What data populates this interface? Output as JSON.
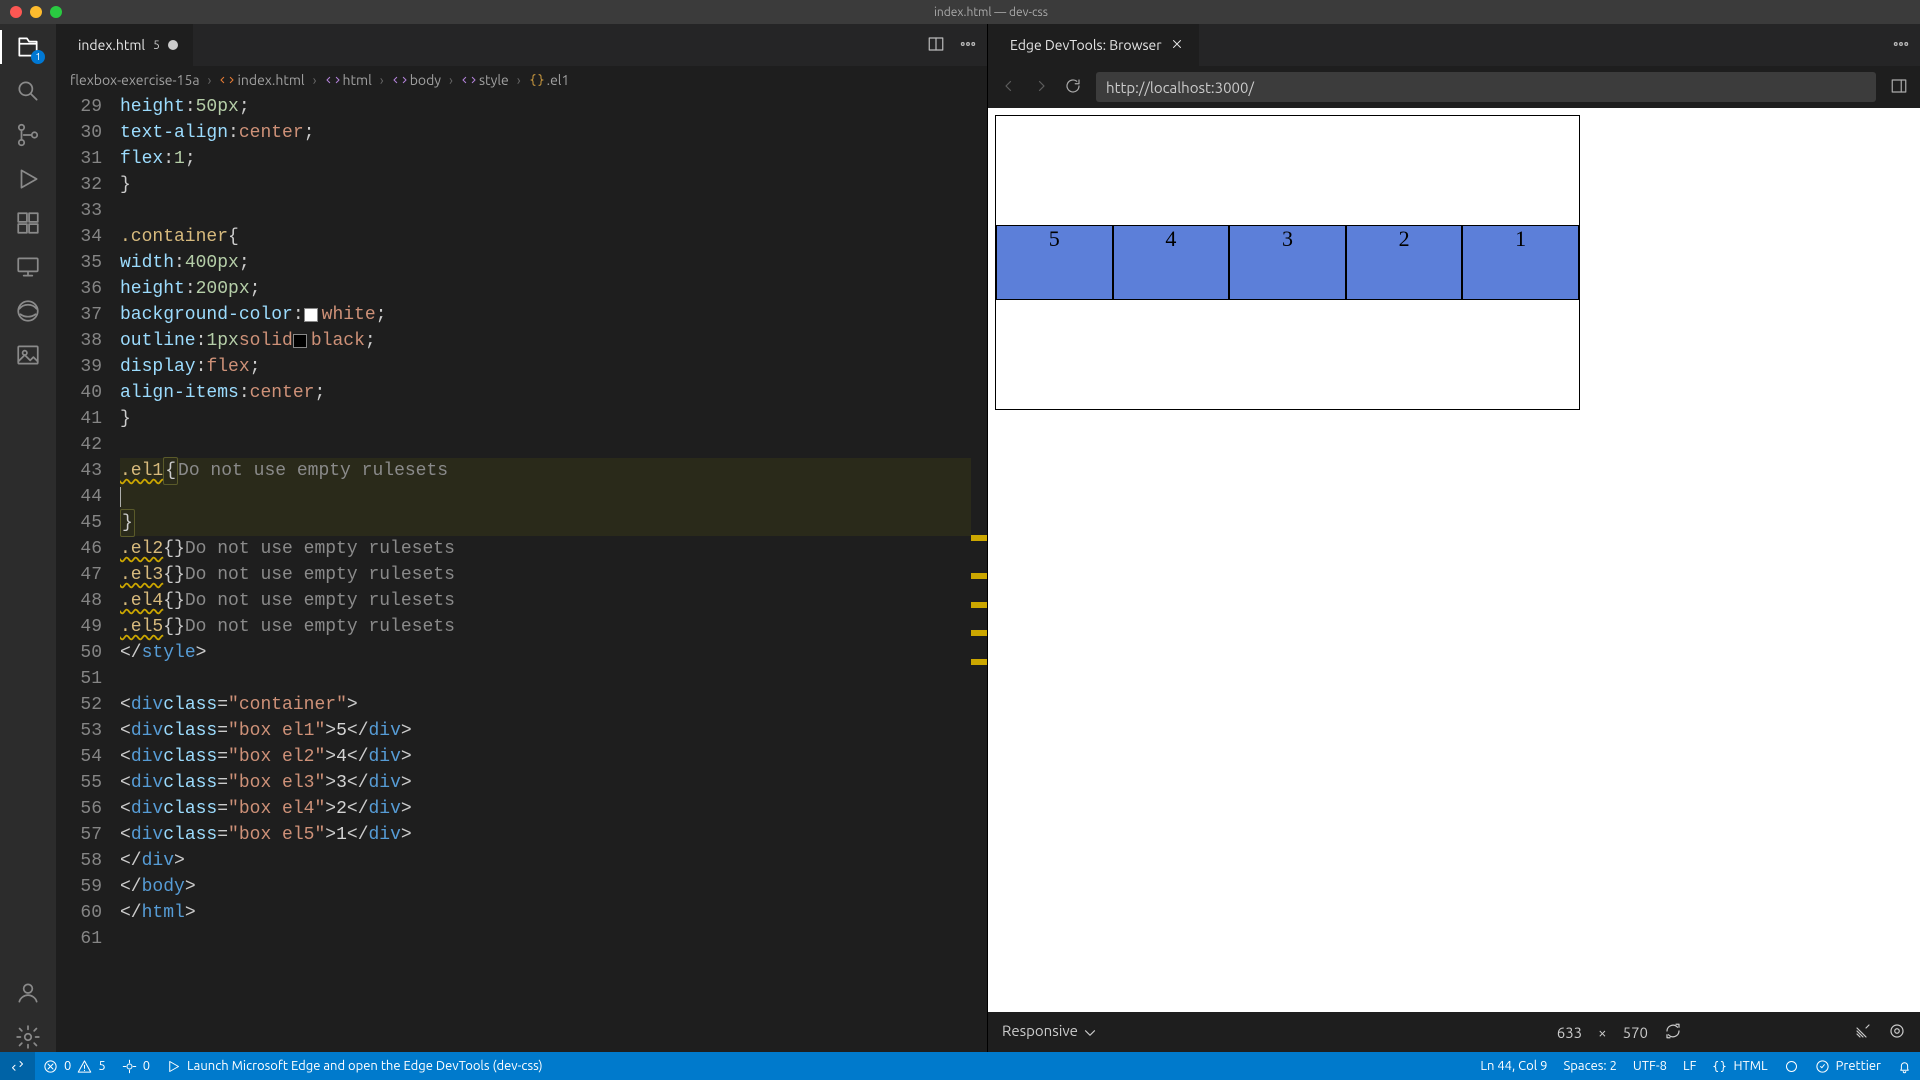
{
  "window": {
    "title": "index.html — dev-css"
  },
  "activitybar": {
    "explorer_badge": "1"
  },
  "left_tab": {
    "filename": "index.html",
    "diag_count": "5"
  },
  "right_tab": {
    "title": "Edge DevTools: Browser"
  },
  "breadcrumbs": {
    "folder": "flexbox-exercise-15a",
    "file": "index.html",
    "seg1": "html",
    "seg2": "body",
    "seg3": "style",
    "seg4": ".el1"
  },
  "gutter_start": 29,
  "lint_msg": "Do not use empty rulesets",
  "code": {
    "l29": "height:50px;",
    "l30a": "text-align:",
    "l30b": "center",
    "l30c": ";",
    "l31a": "flex:",
    "l31b": "1",
    "l31c": ";",
    "l32": "}",
    "l34": ".container {",
    "l35a": "width:",
    "l35b": "400px",
    "l35c": ";",
    "l36a": "height:",
    "l36b": "200px",
    "l36c": ";",
    "l37a": "background-color:",
    "l37b": "white",
    "l37c": ";",
    "l38a": "outline:",
    "l38b": "1px",
    "l38c": "solid",
    "l38d": "black",
    "l38e": ";",
    "l39a": "display:",
    "l39b": "flex",
    "l39c": ";",
    "l40a": "align-items:",
    "l40b": "center",
    "l40c": ";",
    "l41": "}",
    "l43a": ".el1",
    "l43b": "{",
    "l45": "}",
    "l46a": ".el2",
    "l46b": "{}",
    "l47a": ".el3",
    "l47b": "{}",
    "l48a": ".el4",
    "l48b": "{}",
    "l49a": ".el5",
    "l49b": "{}",
    "l50": "</style>",
    "l52": "<div class=\"container\">",
    "l53": "<div class=\"box el1\">5</div>",
    "l54": "<div class=\"box el2\">4</div>",
    "l55": "<div class=\"box el3\">3</div>",
    "l56": "<div class=\"box el4\">2</div>",
    "l57": "<div class=\"box el5\">1</div>",
    "l58": "</div>",
    "l59": "</body>",
    "l60": "</html>"
  },
  "browser": {
    "url": "http://localhost:3000/"
  },
  "preview": {
    "boxes": [
      "5",
      "4",
      "3",
      "2",
      "1"
    ]
  },
  "preview_status": {
    "mode": "Responsive",
    "w": "633",
    "h": "570",
    "sep": "×"
  },
  "statusbar": {
    "errors": "0",
    "warnings": "5",
    "ports": "0",
    "launch": "Launch Microsoft Edge and open the Edge DevTools (dev-css)",
    "lncol": "Ln 44, Col 9",
    "spaces": "Spaces: 2",
    "encoding": "UTF-8",
    "eol": "LF",
    "lang": "HTML",
    "prettier": "Prettier"
  }
}
